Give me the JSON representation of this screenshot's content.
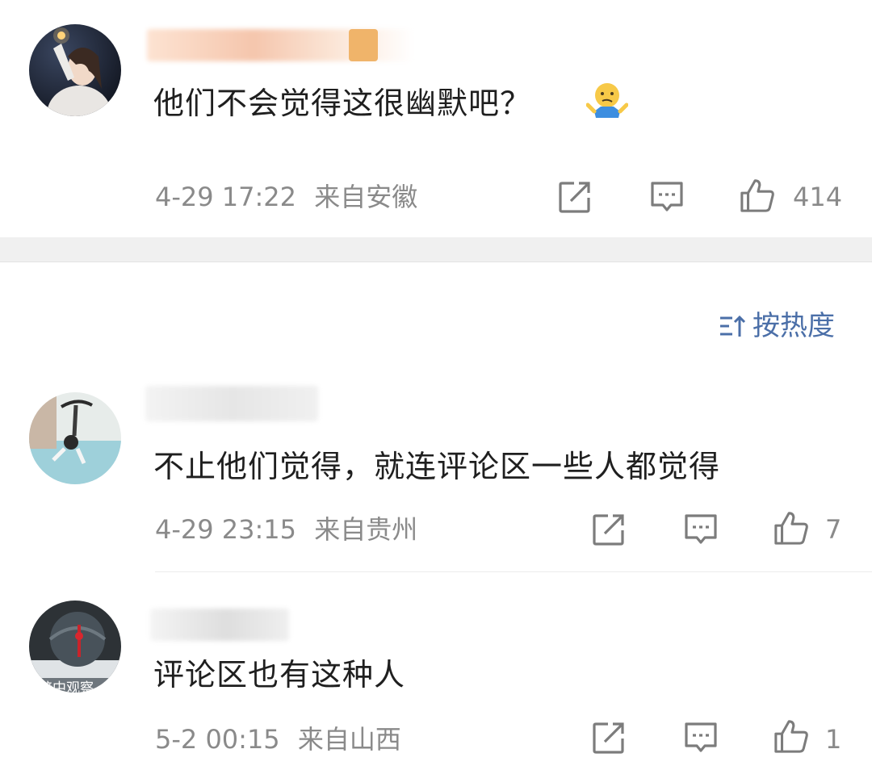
{
  "sort": {
    "label": "按热度"
  },
  "comments": [
    {
      "text": "他们不会觉得这很幽默吧？",
      "date": "4-29 17:22",
      "location": "来自安徽",
      "likes": "414"
    },
    {
      "text": "不止他们觉得，就连评论区一些人都觉得",
      "date": "4-29 23:15",
      "location": "来自贵州",
      "likes": "7"
    },
    {
      "text": "评论区也有这种人",
      "date": "5-2 00:15",
      "location": "来自山西",
      "likes": "1",
      "avatar_text": "暗中观察"
    }
  ],
  "icons": {
    "share": "share-icon",
    "reply": "comment-icon",
    "like": "thumbs-up-icon",
    "emoji": "shrug-emoji-icon",
    "sort": "sort-icon"
  },
  "colors": {
    "text": "#1f1f1f",
    "meta": "#8a8a8a",
    "icon": "#7c7c7c",
    "sort": "#4b6fa8",
    "separator": "#f0f0f0"
  }
}
